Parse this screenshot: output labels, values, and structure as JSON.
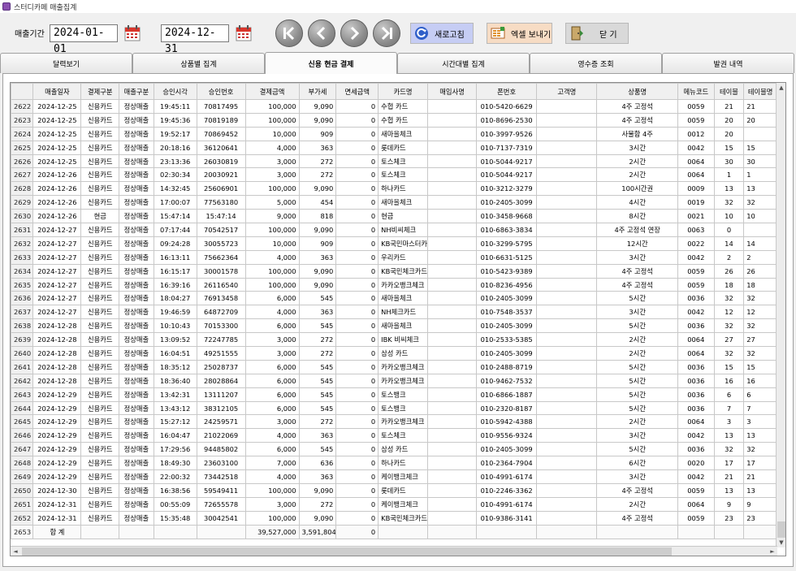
{
  "window": {
    "title": "스터디카페 매출집계"
  },
  "toolbar": {
    "period_label": "매출기간",
    "date_from": "2024-01-01",
    "date_to": "2024-12-31",
    "refresh_label": "새로고침",
    "excel_label": "엑셀 보내기",
    "close_label": "닫 기"
  },
  "tabs": [
    "달력보기",
    "상품별 집계",
    "신용 현금 결제",
    "시간대별 집계",
    "영수증 조회",
    "발권 내역"
  ],
  "active_tab": 2,
  "grid": {
    "columns": [
      "",
      "매출일자",
      "결제구분",
      "매출구분",
      "승인시각",
      "승인번호",
      "결제금액",
      "부가세",
      "면세금액",
      "카드명",
      "매입사명",
      "폰번호",
      "고객명",
      "상품명",
      "메뉴코드",
      "테이블",
      "테이블명"
    ],
    "rows": [
      [
        "2622",
        "2024-12-25",
        "신용카드",
        "정상매출",
        "19:45:11",
        "70817495",
        "100,000",
        "9,090",
        "0",
        "수협 카드",
        "",
        "010-5420-6629",
        "",
        "4주 고정석",
        "0059",
        "21",
        "21"
      ],
      [
        "2623",
        "2024-12-25",
        "신용카드",
        "정상매출",
        "19:45:36",
        "70819189",
        "100,000",
        "9,090",
        "0",
        "수협 카드",
        "",
        "010-8696-2530",
        "",
        "4주 고정석",
        "0059",
        "20",
        "20"
      ],
      [
        "2624",
        "2024-12-25",
        "신용카드",
        "정상매출",
        "19:52:17",
        "70869452",
        "10,000",
        "909",
        "0",
        "새마을체크",
        "",
        "010-3997-9526",
        "",
        "사물함 4주",
        "0012",
        "20",
        ""
      ],
      [
        "2625",
        "2024-12-25",
        "신용카드",
        "정상매출",
        "20:18:16",
        "36120641",
        "4,000",
        "363",
        "0",
        "롯데카드",
        "",
        "010-7137-7319",
        "",
        "3시간",
        "0042",
        "15",
        "15"
      ],
      [
        "2626",
        "2024-12-25",
        "신용카드",
        "정상매출",
        "23:13:36",
        "26030819",
        "3,000",
        "272",
        "0",
        "토스체크",
        "",
        "010-5044-9217",
        "",
        "2시간",
        "0064",
        "30",
        "30"
      ],
      [
        "2627",
        "2024-12-26",
        "신용카드",
        "정상매출",
        "02:30:34",
        "20030921",
        "3,000",
        "272",
        "0",
        "토스체크",
        "",
        "010-5044-9217",
        "",
        "2시간",
        "0064",
        "1",
        "1"
      ],
      [
        "2628",
        "2024-12-26",
        "신용카드",
        "정상매출",
        "14:32:45",
        "25606901",
        "100,000",
        "9,090",
        "0",
        "하나카드",
        "",
        "010-3212-3279",
        "",
        "100시간권",
        "0009",
        "13",
        "13"
      ],
      [
        "2629",
        "2024-12-26",
        "신용카드",
        "정상매출",
        "17:00:07",
        "77563180",
        "5,000",
        "454",
        "0",
        "새마을체크",
        "",
        "010-2405-3099",
        "",
        "4시간",
        "0019",
        "32",
        "32"
      ],
      [
        "2630",
        "2024-12-26",
        "현금",
        "정상매출",
        "15:47:14",
        "15:47:14",
        "9,000",
        "818",
        "0",
        "현금",
        "",
        "010-3458-9668",
        "",
        "8시간",
        "0021",
        "10",
        "10"
      ],
      [
        "2631",
        "2024-12-27",
        "신용카드",
        "정상매출",
        "07:17:44",
        "70542517",
        "100,000",
        "9,090",
        "0",
        "NH비씨체크",
        "",
        "010-6863-3834",
        "",
        "4주 고정석 연장",
        "0063",
        "0",
        ""
      ],
      [
        "2632",
        "2024-12-27",
        "신용카드",
        "정상매출",
        "09:24:28",
        "30055723",
        "10,000",
        "909",
        "0",
        "KB국민마스터카",
        "",
        "010-3299-5795",
        "",
        "12시간",
        "0022",
        "14",
        "14"
      ],
      [
        "2633",
        "2024-12-27",
        "신용카드",
        "정상매출",
        "16:13:11",
        "75662364",
        "4,000",
        "363",
        "0",
        "우리카드",
        "",
        "010-6631-5125",
        "",
        "3시간",
        "0042",
        "2",
        "2"
      ],
      [
        "2634",
        "2024-12-27",
        "신용카드",
        "정상매출",
        "16:15:17",
        "30001578",
        "100,000",
        "9,090",
        "0",
        "KB국민체크카드",
        "",
        "010-5423-9389",
        "",
        "4주 고정석",
        "0059",
        "26",
        "26"
      ],
      [
        "2635",
        "2024-12-27",
        "신용카드",
        "정상매출",
        "16:39:16",
        "26116540",
        "100,000",
        "9,090",
        "0",
        "카카오뱅크체크",
        "",
        "010-8236-4956",
        "",
        "4주 고정석",
        "0059",
        "18",
        "18"
      ],
      [
        "2636",
        "2024-12-27",
        "신용카드",
        "정상매출",
        "18:04:27",
        "76913458",
        "6,000",
        "545",
        "0",
        "새마을체크",
        "",
        "010-2405-3099",
        "",
        "5시간",
        "0036",
        "32",
        "32"
      ],
      [
        "2637",
        "2024-12-27",
        "신용카드",
        "정상매출",
        "19:46:59",
        "64872709",
        "4,000",
        "363",
        "0",
        "NH체크카드",
        "",
        "010-7548-3537",
        "",
        "3시간",
        "0042",
        "12",
        "12"
      ],
      [
        "2638",
        "2024-12-28",
        "신용카드",
        "정상매출",
        "10:10:43",
        "70153300",
        "6,000",
        "545",
        "0",
        "새마을체크",
        "",
        "010-2405-3099",
        "",
        "5시간",
        "0036",
        "32",
        "32"
      ],
      [
        "2639",
        "2024-12-28",
        "신용카드",
        "정상매출",
        "13:09:52",
        "72247785",
        "3,000",
        "272",
        "0",
        "IBK 비씨체크",
        "",
        "010-2533-5385",
        "",
        "2시간",
        "0064",
        "27",
        "27"
      ],
      [
        "2640",
        "2024-12-28",
        "신용카드",
        "정상매출",
        "16:04:51",
        "49251555",
        "3,000",
        "272",
        "0",
        "삼성 카드",
        "",
        "010-2405-3099",
        "",
        "2시간",
        "0064",
        "32",
        "32"
      ],
      [
        "2641",
        "2024-12-28",
        "신용카드",
        "정상매출",
        "18:35:12",
        "25028737",
        "6,000",
        "545",
        "0",
        "카카오뱅크체크",
        "",
        "010-2488-8719",
        "",
        "5시간",
        "0036",
        "15",
        "15"
      ],
      [
        "2642",
        "2024-12-28",
        "신용카드",
        "정상매출",
        "18:36:40",
        "28028864",
        "6,000",
        "545",
        "0",
        "카카오뱅크체크",
        "",
        "010-9462-7532",
        "",
        "5시간",
        "0036",
        "16",
        "16"
      ],
      [
        "2643",
        "2024-12-29",
        "신용카드",
        "정상매출",
        "13:42:31",
        "13111207",
        "6,000",
        "545",
        "0",
        "토스뱅크",
        "",
        "010-6866-1887",
        "",
        "5시간",
        "0036",
        "6",
        "6"
      ],
      [
        "2644",
        "2024-12-29",
        "신용카드",
        "정상매출",
        "13:43:12",
        "38312105",
        "6,000",
        "545",
        "0",
        "토스뱅크",
        "",
        "010-2320-8187",
        "",
        "5시간",
        "0036",
        "7",
        "7"
      ],
      [
        "2645",
        "2024-12-29",
        "신용카드",
        "정상매출",
        "15:27:12",
        "24259571",
        "3,000",
        "272",
        "0",
        "카카오뱅크체크",
        "",
        "010-5942-4388",
        "",
        "2시간",
        "0064",
        "3",
        "3"
      ],
      [
        "2646",
        "2024-12-29",
        "신용카드",
        "정상매출",
        "16:04:47",
        "21022069",
        "4,000",
        "363",
        "0",
        "토스체크",
        "",
        "010-9556-9324",
        "",
        "3시간",
        "0042",
        "13",
        "13"
      ],
      [
        "2647",
        "2024-12-29",
        "신용카드",
        "정상매출",
        "17:29:56",
        "94485802",
        "6,000",
        "545",
        "0",
        "삼성 카드",
        "",
        "010-2405-3099",
        "",
        "5시간",
        "0036",
        "32",
        "32"
      ],
      [
        "2648",
        "2024-12-29",
        "신용카드",
        "정상매출",
        "18:49:30",
        "23603100",
        "7,000",
        "636",
        "0",
        "하나카드",
        "",
        "010-2364-7904",
        "",
        "6시간",
        "0020",
        "17",
        "17"
      ],
      [
        "2649",
        "2024-12-29",
        "신용카드",
        "정상매출",
        "22:00:32",
        "73442518",
        "4,000",
        "363",
        "0",
        "케이뱅크체크",
        "",
        "010-4991-6174",
        "",
        "3시간",
        "0042",
        "21",
        "21"
      ],
      [
        "2650",
        "2024-12-30",
        "신용카드",
        "정상매출",
        "16:38:56",
        "59549411",
        "100,000",
        "9,090",
        "0",
        "롯데카드",
        "",
        "010-2246-3362",
        "",
        "4주 고정석",
        "0059",
        "13",
        "13"
      ],
      [
        "2651",
        "2024-12-31",
        "신용카드",
        "정상매출",
        "00:55:09",
        "72655578",
        "3,000",
        "272",
        "0",
        "케이뱅크체크",
        "",
        "010-4991-6174",
        "",
        "2시간",
        "0064",
        "9",
        "9"
      ],
      [
        "2652",
        "2024-12-31",
        "신용카드",
        "정상매출",
        "15:35:48",
        "30042541",
        "100,000",
        "9,090",
        "0",
        "KB국민체크카드",
        "",
        "010-9386-3141",
        "",
        "4주 고정석",
        "0059",
        "23",
        "23"
      ]
    ],
    "total_row": [
      "2653",
      "합 계",
      "",
      "",
      "",
      "",
      "39,527,000",
      "3,591,804",
      "0",
      "",
      "",
      "",
      "",
      "",
      "",
      "",
      ""
    ]
  },
  "colors": {
    "refresh_bg": "#c6cdf4",
    "excel_bg": "#f7dcc4",
    "close_bg": "#d9d9d9",
    "nav_btn": "#8c8c8c"
  },
  "icons": [
    "calendar-icon",
    "first-icon",
    "prev-icon",
    "next-icon",
    "last-icon",
    "refresh-icon",
    "excel-icon",
    "exit-door-icon"
  ]
}
